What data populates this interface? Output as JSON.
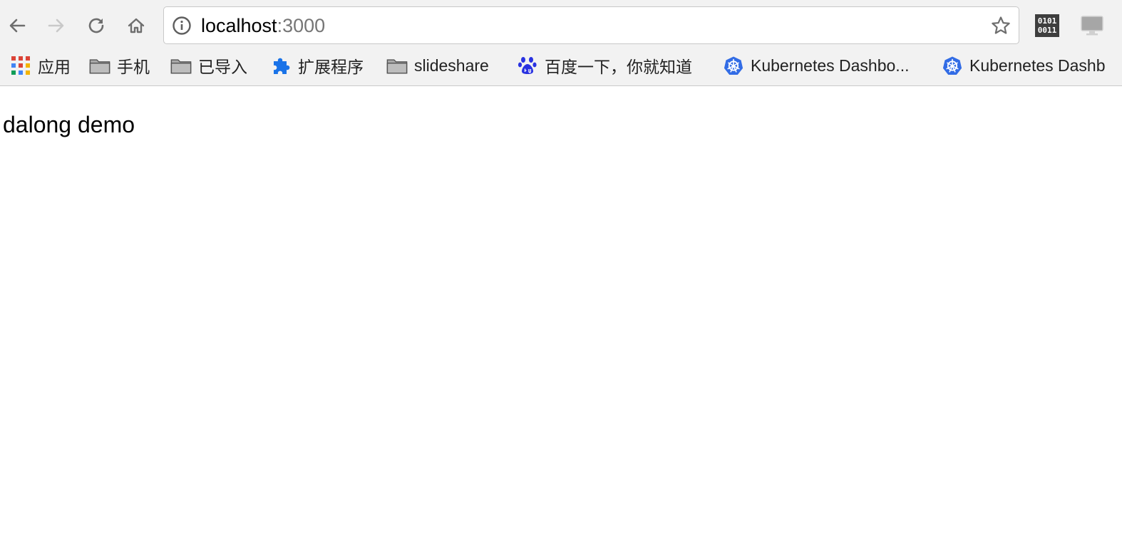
{
  "browser": {
    "url_host": "localhost",
    "url_port": ":3000",
    "extensions": {
      "binary_label_line1": "0101",
      "binary_label_line2": "0011"
    }
  },
  "bookmarks": [
    {
      "label": "应用",
      "icon": "apps-grid-icon"
    },
    {
      "label": "手机",
      "icon": "folder-icon"
    },
    {
      "label": "已导入",
      "icon": "folder-icon"
    },
    {
      "label": "扩展程序",
      "icon": "puzzle-piece-icon"
    },
    {
      "label": "slideshare",
      "icon": "folder-icon"
    },
    {
      "label": "百度一下，你就知道",
      "icon": "baidu-paw-icon"
    },
    {
      "label": "Kubernetes Dashbo...",
      "icon": "kubernetes-icon"
    },
    {
      "label": "Kubernetes Dashb",
      "icon": "kubernetes-icon"
    }
  ],
  "page": {
    "text": "dalong demo"
  },
  "colors": {
    "chrome_bg": "#f2f2f2",
    "icon_gray": "#6e6e6e",
    "puzzle_blue": "#1a73e8",
    "kubernetes_blue": "#326ce5",
    "baidu_blue": "#2932e1"
  }
}
